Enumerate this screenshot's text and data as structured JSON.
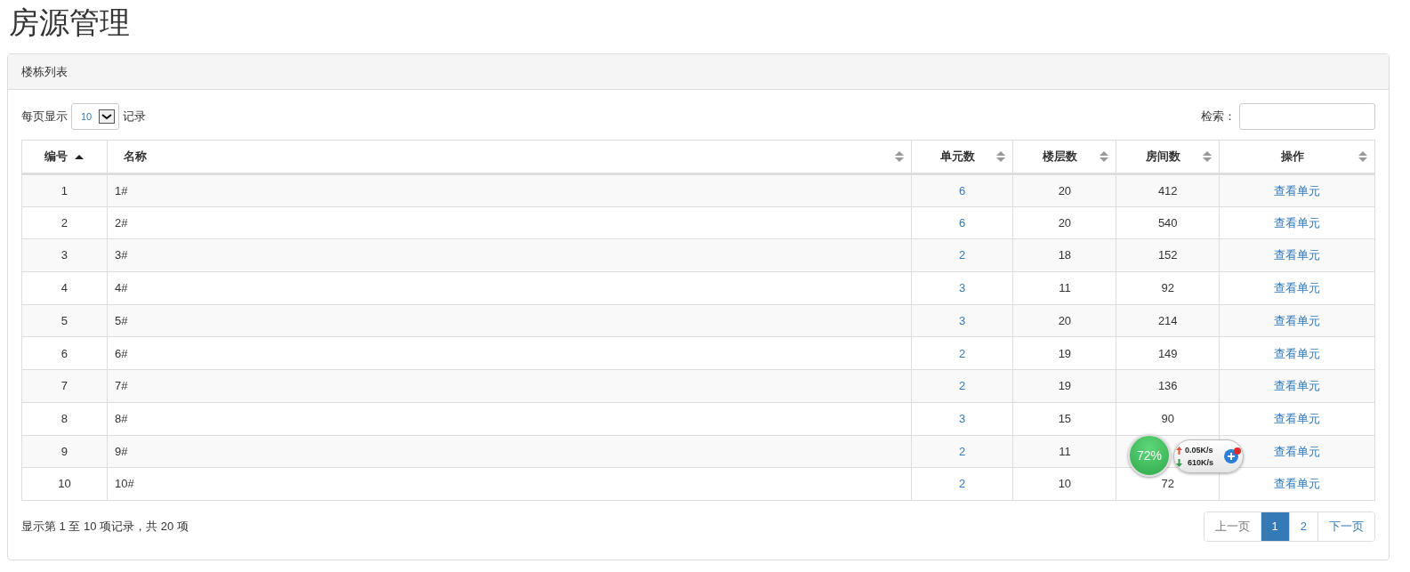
{
  "page_title": "房源管理",
  "panel": {
    "title": "楼栋列表",
    "length": {
      "before": "每页显示",
      "value": "10",
      "after": "记录"
    },
    "search": {
      "label": "检索："
    },
    "table": {
      "columns": [
        {
          "label": "编号",
          "sorted": true
        },
        {
          "label": "名称",
          "sorted": false
        },
        {
          "label": "单元数",
          "sorted": false
        },
        {
          "label": "楼层数",
          "sorted": false
        },
        {
          "label": "房间数",
          "sorted": false
        },
        {
          "label": "操作",
          "sorted": false
        }
      ],
      "rows": [
        {
          "id": "1",
          "name": "1#",
          "units": "6",
          "floors": "20",
          "rooms": "412",
          "action": "查看单元"
        },
        {
          "id": "2",
          "name": "2#",
          "units": "6",
          "floors": "20",
          "rooms": "540",
          "action": "查看单元"
        },
        {
          "id": "3",
          "name": "3#",
          "units": "2",
          "floors": "18",
          "rooms": "152",
          "action": "查看单元"
        },
        {
          "id": "4",
          "name": "4#",
          "units": "3",
          "floors": "11",
          "rooms": "92",
          "action": "查看单元"
        },
        {
          "id": "5",
          "name": "5#",
          "units": "3",
          "floors": "20",
          "rooms": "214",
          "action": "查看单元"
        },
        {
          "id": "6",
          "name": "6#",
          "units": "2",
          "floors": "19",
          "rooms": "149",
          "action": "查看单元"
        },
        {
          "id": "7",
          "name": "7#",
          "units": "2",
          "floors": "19",
          "rooms": "136",
          "action": "查看单元"
        },
        {
          "id": "8",
          "name": "8#",
          "units": "3",
          "floors": "15",
          "rooms": "90",
          "action": "查看单元"
        },
        {
          "id": "9",
          "name": "9#",
          "units": "2",
          "floors": "11",
          "action": "查看单元"
        },
        {
          "id": "10",
          "name": "10#",
          "units": "2",
          "floors": "10",
          "rooms": "72",
          "action": "查看单元"
        }
      ]
    },
    "info": "显示第 1 至 10 项记录，共 20 项",
    "pagination": [
      {
        "label": "上一页",
        "selected": false,
        "disabled": true
      },
      {
        "label": "1",
        "selected": true,
        "disabled": false
      },
      {
        "label": "2",
        "selected": false,
        "disabled": false
      },
      {
        "label": "下一页",
        "selected": false,
        "disabled": false
      }
    ]
  },
  "speed_widget": {
    "percent": "72%",
    "upload": "0.05K/s",
    "download": "610K/s"
  }
}
